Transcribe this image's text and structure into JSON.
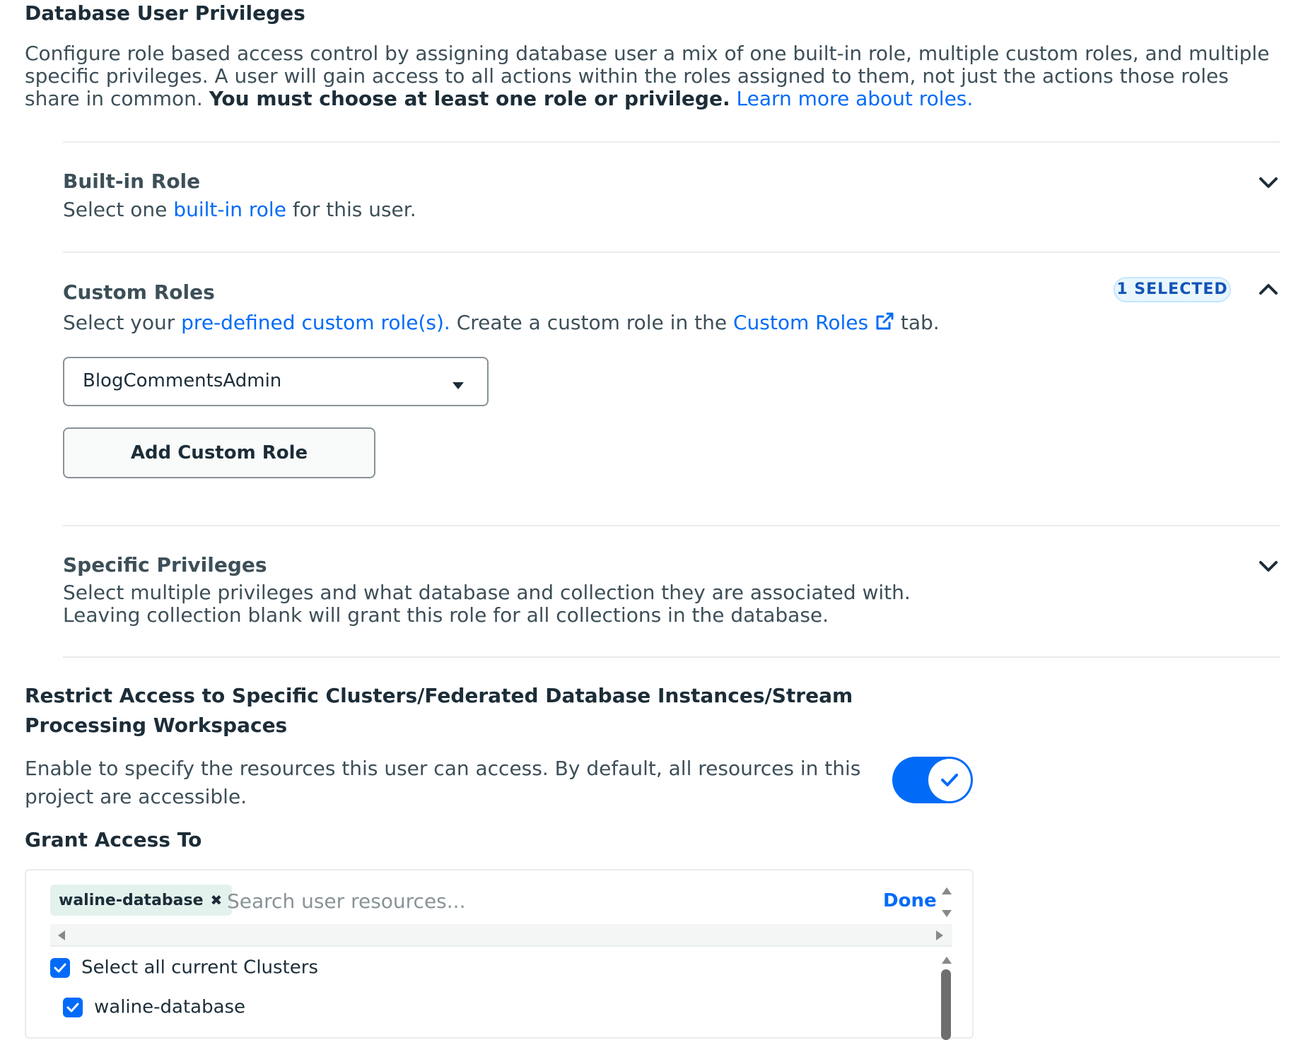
{
  "privileges": {
    "title": "Database User Privileges",
    "intro_text": "Configure role based access control by assigning database user a mix of one built-in role, multiple custom roles, and multiple specific privileges. A user will gain access to all actions within the roles assigned to them, not just the actions those roles share in common.",
    "intro_bold": "You must choose at least one role or privilege.",
    "intro_link": "Learn more about roles."
  },
  "built_in_role": {
    "title": "Built-in Role",
    "desc_prefix": "Select one",
    "desc_link": "built-in role",
    "desc_suffix": "for this user.",
    "chevron_icon": "chevron-down-icon"
  },
  "custom_roles": {
    "title": "Custom Roles",
    "badge": "1 SELECTED",
    "desc_prefix": "Select your",
    "desc_link": "pre-defined custom role(s).",
    "desc_middle": "Create a custom role in the",
    "tab_link": "Custom Roles",
    "desc_suffix": "tab.",
    "selected_role": "BlogCommentsAdmin",
    "add_button": "Add Custom Role",
    "chevron_icon": "chevron-up-icon"
  },
  "specific_privileges": {
    "title": "Specific Privileges",
    "desc_line1": "Select multiple privileges and what database and collection they are associated with.",
    "desc_line2": "Leaving collection blank will grant this role for all collections in the database.",
    "chevron_icon": "chevron-down-icon"
  },
  "restrict_access": {
    "title": "Restrict Access to Specific Clusters/Federated Database Instances/Stream Processing Workspaces",
    "desc": "Enable to specify the resources this user can access. By default, all resources in this project are accessible.",
    "toggle_on": true
  },
  "grant_access": {
    "title": "Grant Access To",
    "chip_label": "waline-database",
    "search_placeholder": "Search user resources...",
    "done_label": "Done",
    "select_all_label": "Select all current Clusters",
    "select_all_checked": true,
    "items": [
      {
        "label": "waline-database",
        "checked": true
      }
    ]
  },
  "colors": {
    "accent": "#016bf8",
    "badge_bg": "#e9f6fe",
    "badge_text": "#1254b7",
    "chip_bg": "#e3f2ec"
  }
}
